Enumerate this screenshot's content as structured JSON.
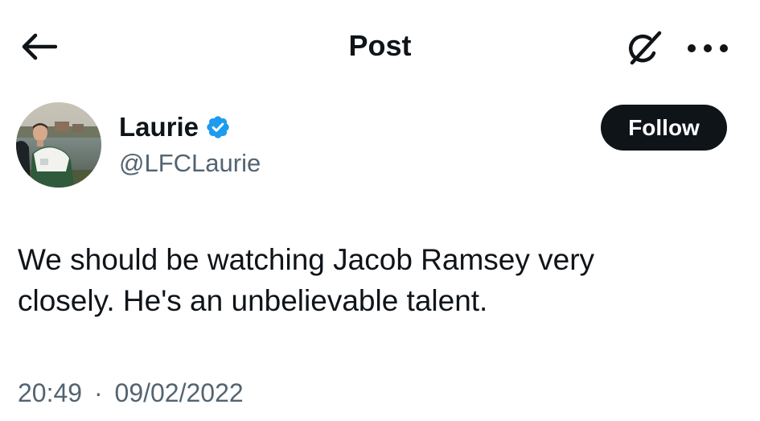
{
  "header": {
    "title": "Post",
    "back_icon": "arrow-left-icon",
    "grok_icon": "grok-icon",
    "more_icon": "more-horizontal-icon"
  },
  "author": {
    "name": "Laurie",
    "handle": "@LFCLaurie",
    "verified": true,
    "verified_color": "#1d9bf0"
  },
  "follow_button": {
    "label": "Follow"
  },
  "tweet": {
    "text": "We should be watching Jacob Ramsey very\ncloselу. He's an unbelievable talent."
  },
  "meta": {
    "time": "20:49",
    "separator": "·",
    "date": "09/02/2022"
  }
}
